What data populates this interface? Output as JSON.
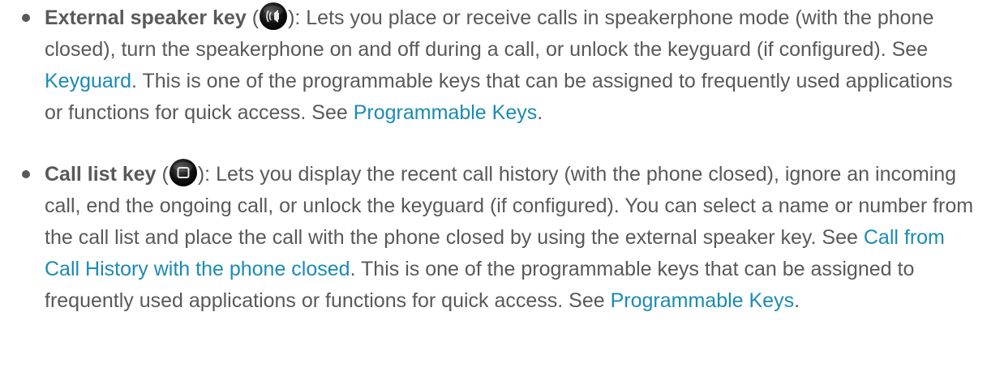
{
  "items": [
    {
      "term": "External speaker key",
      "open_paren": " (",
      "icon": "speaker-key-icon",
      "text1": "): Lets you place or receive calls in speakerphone mode (with the phone closed), turn the speakerphone on and off during a call, or unlock the keyguard (if configured). See ",
      "link1": "Keyguard",
      "text2": ". This is one of the programmable keys that can be assigned to frequently used applications or functions for quick access. See ",
      "link2": "Programmable Keys",
      "text3": "."
    },
    {
      "term": "Call list key",
      "open_paren": " (",
      "icon": "call-list-key-icon",
      "text1": "): Lets you display the recent call history (with the phone closed), ignore an incoming call, end the ongoing call, or unlock the keyguard (if configured). You can select a name or number from the call list and place the call with the phone closed by using the external speaker key. See ",
      "link1": "Call from Call History with the phone closed",
      "text2": ". This is one of the programmable keys that can be assigned to frequently used applications or functions for quick access. See ",
      "link2": "Programmable Keys",
      "text3": "."
    }
  ]
}
